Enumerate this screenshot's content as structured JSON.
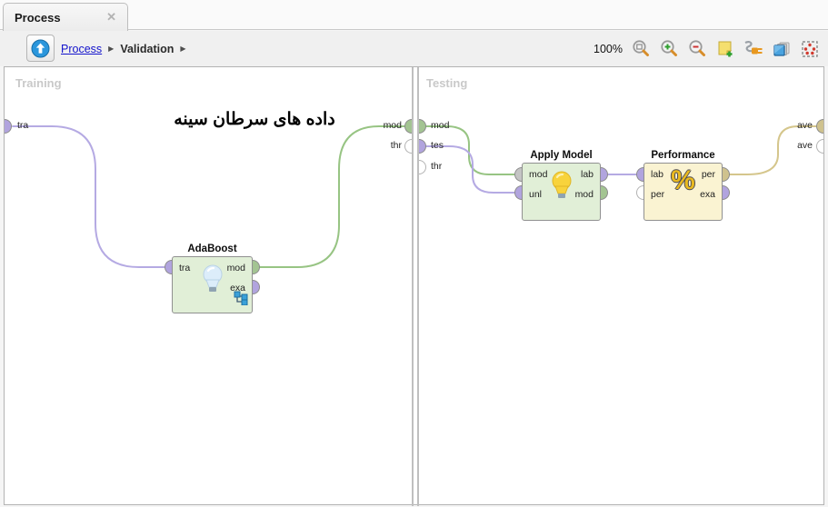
{
  "tab": {
    "label": "Process",
    "close_glyph": "✕"
  },
  "breadcrumb": {
    "link": "Process",
    "separator": "▶",
    "current": "Validation"
  },
  "toolbar": {
    "zoom_level": "100%",
    "icons": [
      "zoom-reset",
      "zoom-in",
      "zoom-out",
      "add-note",
      "auto-wire",
      "arrange-layers",
      "fit-view"
    ]
  },
  "panels": {
    "training": {
      "label": "Training",
      "annotation": "داده های سرطان سینه",
      "source_ports": [
        {
          "label": "tra"
        }
      ],
      "sink_ports": [
        {
          "label": "mod"
        },
        {
          "label": "thr"
        }
      ],
      "operators": [
        {
          "name": "AdaBoost",
          "icon": "lightbulb-blue-icon",
          "inputs": [
            {
              "label": "tra"
            }
          ],
          "outputs": [
            {
              "label": "mod"
            },
            {
              "label": "exa"
            }
          ]
        }
      ]
    },
    "testing": {
      "label": "Testing",
      "source_ports": [
        {
          "label": "mod"
        },
        {
          "label": "tes"
        },
        {
          "label": "thr"
        }
      ],
      "sink_ports": [
        {
          "label": "ave"
        },
        {
          "label": "ave"
        }
      ],
      "operators": [
        {
          "name": "Apply Model",
          "icon": "lightbulb-yellow-icon",
          "inputs": [
            {
              "label": "mod"
            },
            {
              "label": "unl"
            }
          ],
          "outputs": [
            {
              "label": "lab"
            },
            {
              "label": "mod"
            }
          ]
        },
        {
          "name": "Performance",
          "icon": "%",
          "inputs": [
            {
              "label": "lab"
            },
            {
              "label": "per"
            }
          ],
          "outputs": [
            {
              "label": "per"
            },
            {
              "label": "exa"
            }
          ]
        }
      ]
    }
  },
  "colors": {
    "port_purple": "#b1a4de",
    "port_green": "#a3c492",
    "port_tan": "#cfc28e",
    "port_gray": "#c4c4c4",
    "operator_green": "#e1efd7",
    "operator_yellow": "#faf3d2",
    "wire_purple": "#b5aae3",
    "wire_green": "#97c483",
    "wire_tan": "#d5c68c",
    "link_blue": "#1414cc"
  }
}
